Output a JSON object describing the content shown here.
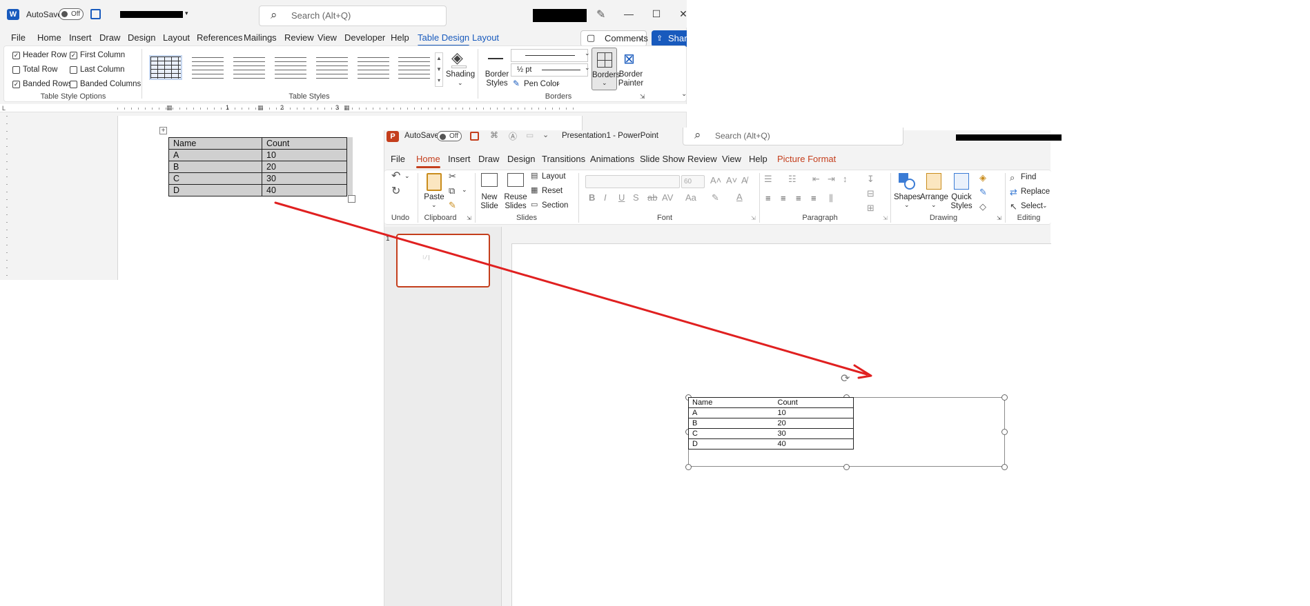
{
  "word": {
    "autosave_label": "AutoSave",
    "autosave_state": "Off",
    "search_placeholder": "Search (Alt+Q)",
    "menu": [
      "File",
      "Home",
      "Insert",
      "Draw",
      "Design",
      "Layout",
      "References",
      "Mailings",
      "Review",
      "View",
      "Developer",
      "Help",
      "Table Design",
      "Layout"
    ],
    "active_menu": "Table Design",
    "comments_label": "Comments",
    "share_label": "Share",
    "style_options": {
      "header_row": "Header Row",
      "first_column": "First Column",
      "total_row": "Total Row",
      "last_column": "Last Column",
      "banded_rows": "Banded Rows",
      "banded_columns": "Banded Columns",
      "group_title": "Table Style Options"
    },
    "table_styles_title": "Table Styles",
    "shading_label": "Shading",
    "border_styles_label": "Border\nStyles",
    "pen_weight": "½ pt",
    "pen_color_label": "Pen Color",
    "borders_label": "Borders",
    "border_painter_label": "Border\nPainter",
    "borders_group_title": "Borders",
    "ruler_numbers": [
      "1",
      "2",
      "3"
    ],
    "table": {
      "headers": [
        "Name",
        "Count"
      ],
      "rows": [
        [
          "A",
          "10"
        ],
        [
          "B",
          "20"
        ],
        [
          "C",
          "30"
        ],
        [
          "D",
          "40"
        ]
      ]
    }
  },
  "ppt": {
    "autosave_label": "AutoSave",
    "autosave_state": "Off",
    "title": "Presentation1  -  PowerPoint",
    "search_placeholder": "Search (Alt+Q)",
    "menu": [
      "File",
      "Home",
      "Insert",
      "Draw",
      "Design",
      "Transitions",
      "Animations",
      "Slide Show",
      "Review",
      "View",
      "Help",
      "Picture Format"
    ],
    "active_menu": "Home",
    "groups": {
      "undo": "Undo",
      "clipboard": "Clipboard",
      "slides": "Slides",
      "font": "Font",
      "paragraph": "Paragraph",
      "drawing": "Drawing",
      "editing": "Editing"
    },
    "buttons": {
      "paste": "Paste",
      "new_slide": "New\nSlide",
      "reuse_slides": "Reuse\nSlides",
      "layout": "Layout",
      "reset": "Reset",
      "section": "Section",
      "font_size": "60",
      "shapes": "Shapes",
      "arrange": "Arrange",
      "quick_styles": "Quick\nStyles",
      "find": "Find",
      "replace": "Replace",
      "select": "Select"
    },
    "slide_number": "1",
    "table": {
      "headers": [
        "Name",
        "Count"
      ],
      "rows": [
        [
          "A",
          "10"
        ],
        [
          "B",
          "20"
        ],
        [
          "C",
          "30"
        ],
        [
          "D",
          "40"
        ]
      ]
    }
  },
  "colors": {
    "word_accent": "#185abd",
    "ppt_accent": "#c43e1c",
    "annotation": "#e02020"
  }
}
